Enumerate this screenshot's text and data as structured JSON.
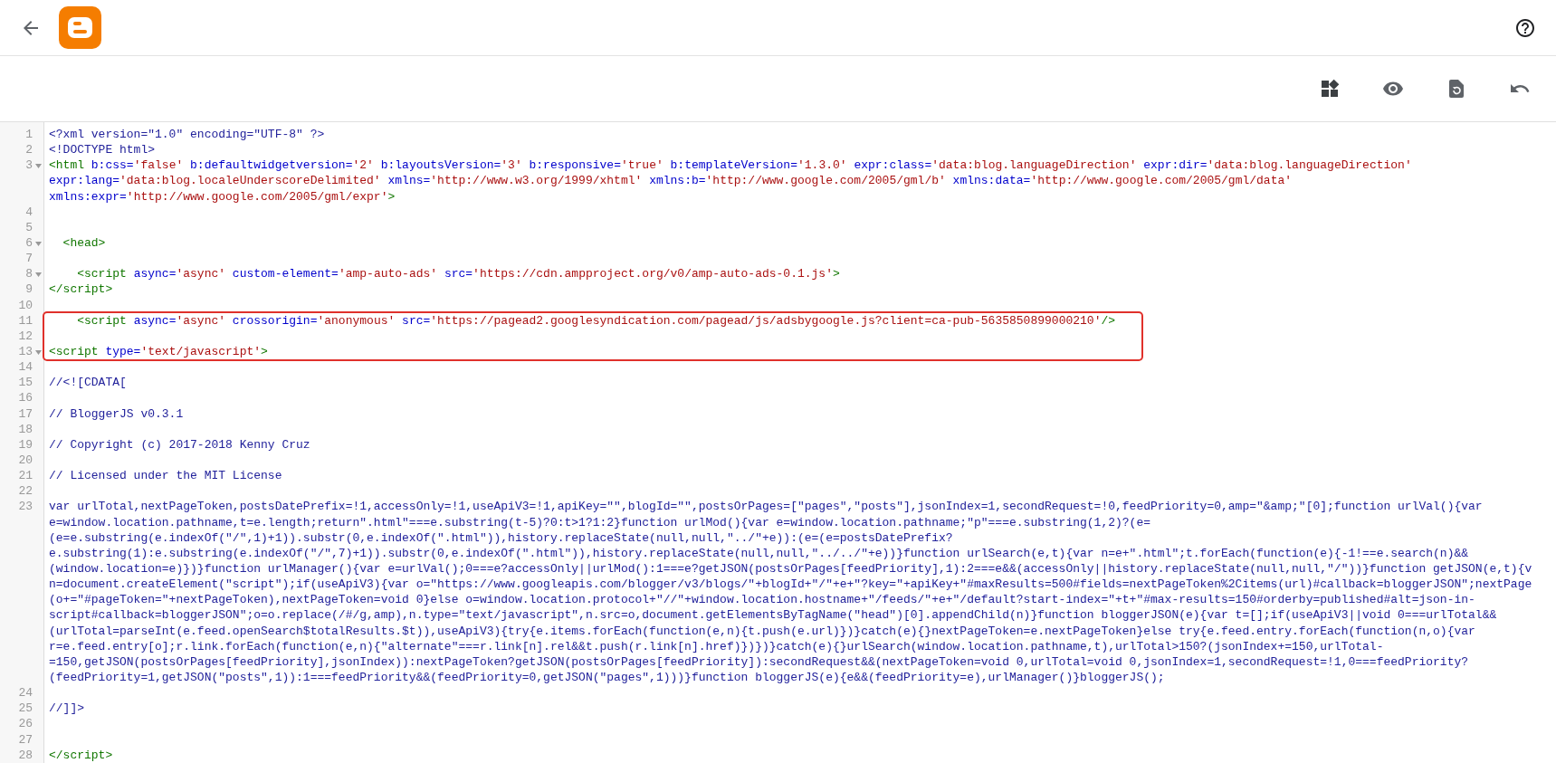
{
  "lines": [
    {
      "number": "1",
      "foldable": false,
      "highlighted": false,
      "rows": [
        {
          "segments": [
            {
              "kind": "plain",
              "text": "<?xml version=\"1.0\" encoding=\"UTF-8\" ?>"
            }
          ]
        }
      ]
    },
    {
      "number": "2",
      "foldable": false,
      "highlighted": false,
      "rows": [
        {
          "segments": [
            {
              "kind": "plain",
              "text": "<!DOCTYPE html>"
            }
          ]
        }
      ]
    },
    {
      "number": "3",
      "foldable": true,
      "highlighted": false,
      "rows": [
        {
          "segments": [
            {
              "kind": "tag",
              "text": "<html"
            },
            {
              "kind": "attr",
              "text": " b:css="
            },
            {
              "kind": "value",
              "text": "'false'"
            },
            {
              "kind": "attr",
              "text": " b:defaultwidgetversion="
            },
            {
              "kind": "value",
              "text": "'2'"
            },
            {
              "kind": "attr",
              "text": " b:layoutsVersion="
            },
            {
              "kind": "value",
              "text": "'3'"
            },
            {
              "kind": "attr",
              "text": " b:responsive="
            },
            {
              "kind": "value",
              "text": "'true'"
            },
            {
              "kind": "attr",
              "text": " b:templateVersion="
            },
            {
              "kind": "value",
              "text": "'1.3.0'"
            },
            {
              "kind": "attr",
              "text": " expr:class="
            },
            {
              "kind": "value",
              "text": "'data:blog.languageDirection'"
            },
            {
              "kind": "attr",
              "text": " expr:dir="
            },
            {
              "kind": "value",
              "text": "'data:blog.languageDirection'"
            }
          ]
        },
        {
          "segments": [
            {
              "kind": "attr",
              "text": "expr:lang="
            },
            {
              "kind": "value",
              "text": "'data:blog.localeUnderscoreDelimited'"
            },
            {
              "kind": "attr",
              "text": " xmlns="
            },
            {
              "kind": "value",
              "text": "'http://www.w3.org/1999/xhtml'"
            },
            {
              "kind": "attr",
              "text": " xmlns:b="
            },
            {
              "kind": "value",
              "text": "'http://www.google.com/2005/gml/b'"
            },
            {
              "kind": "attr",
              "text": " xmlns:data="
            },
            {
              "kind": "value",
              "text": "'http://www.google.com/2005/gml/data'"
            }
          ]
        },
        {
          "segments": [
            {
              "kind": "attr",
              "text": "xmlns:expr="
            },
            {
              "kind": "value",
              "text": "'http://www.google.com/2005/gml/expr'"
            },
            {
              "kind": "tag",
              "text": ">"
            }
          ]
        }
      ]
    },
    {
      "number": "4",
      "foldable": false,
      "highlighted": false
    },
    {
      "number": "5",
      "foldable": false,
      "highlighted": false
    },
    {
      "number": "6",
      "foldable": true,
      "highlighted": false,
      "rows": [
        {
          "segments": [
            {
              "kind": "tag",
              "text": "  <head>"
            }
          ]
        }
      ]
    },
    {
      "number": "7",
      "foldable": false,
      "highlighted": false
    },
    {
      "number": "8",
      "foldable": true,
      "highlighted": false,
      "rows": [
        {
          "segments": [
            {
              "kind": "tag",
              "text": "    <script"
            },
            {
              "kind": "attr",
              "text": " async="
            },
            {
              "kind": "value",
              "text": "'async'"
            },
            {
              "kind": "attr",
              "text": " custom-element="
            },
            {
              "kind": "value",
              "text": "'amp-auto-ads'"
            },
            {
              "kind": "attr",
              "text": " src="
            },
            {
              "kind": "value",
              "text": "'https://cdn.ampproject.org/v0/amp-auto-ads-0.1.js'"
            },
            {
              "kind": "tag",
              "text": ">"
            }
          ]
        }
      ]
    },
    {
      "number": "9",
      "foldable": false,
      "highlighted": false,
      "rows": [
        {
          "segments": [
            {
              "kind": "tag",
              "text": "</script>"
            }
          ]
        }
      ]
    },
    {
      "number": "10",
      "foldable": false,
      "highlighted": false
    },
    {
      "number": "11",
      "foldable": false,
      "highlighted": true,
      "rows": [
        {
          "segments": [
            {
              "kind": "tag",
              "text": "    <script"
            },
            {
              "kind": "attr",
              "text": " async="
            },
            {
              "kind": "value",
              "text": "'async'"
            },
            {
              "kind": "attr",
              "text": " crossorigin="
            },
            {
              "kind": "value",
              "text": "'anonymous'"
            },
            {
              "kind": "attr",
              "text": " src="
            },
            {
              "kind": "value",
              "text": "'https://pagead2.googlesyndication.com/pagead/js/adsbygoogle.js?client=ca-pub-5635850899000210'"
            },
            {
              "kind": "tag",
              "text": "/>"
            }
          ]
        }
      ]
    },
    {
      "number": "12",
      "foldable": false,
      "highlighted": true
    },
    {
      "number": "13",
      "foldable": true,
      "highlighted": true,
      "rows": [
        {
          "segments": [
            {
              "kind": "tag",
              "text": "<script"
            },
            {
              "kind": "attr",
              "text": " type="
            },
            {
              "kind": "value",
              "text": "'text/javascript'"
            },
            {
              "kind": "tag",
              "text": ">"
            }
          ]
        }
      ]
    },
    {
      "number": "14",
      "foldable": false,
      "highlighted": false
    },
    {
      "number": "15",
      "foldable": false,
      "highlighted": false,
      "rows": [
        {
          "segments": [
            {
              "kind": "plain",
              "text": "//<![CDATA["
            }
          ]
        }
      ]
    },
    {
      "number": "16",
      "foldable": false,
      "highlighted": false
    },
    {
      "number": "17",
      "foldable": false,
      "highlighted": false,
      "rows": [
        {
          "segments": [
            {
              "kind": "plain",
              "text": "// BloggerJS v0.3.1"
            }
          ]
        }
      ]
    },
    {
      "number": "18",
      "foldable": false,
      "highlighted": false
    },
    {
      "number": "19",
      "foldable": false,
      "highlighted": false,
      "rows": [
        {
          "segments": [
            {
              "kind": "plain",
              "text": "// Copyright (c) 2017-2018 Kenny Cruz"
            }
          ]
        }
      ]
    },
    {
      "number": "20",
      "foldable": false,
      "highlighted": false
    },
    {
      "number": "21",
      "foldable": false,
      "highlighted": false,
      "rows": [
        {
          "segments": [
            {
              "kind": "plain",
              "text": "// Licensed under the MIT License"
            }
          ]
        }
      ]
    },
    {
      "number": "22",
      "foldable": false,
      "highlighted": false
    },
    {
      "number": "23",
      "foldable": false,
      "highlighted": false,
      "rows": [
        {
          "segments": [
            {
              "kind": "plain",
              "text": "var urlTotal,nextPageToken,postsDatePrefix=!1,accessOnly=!1,useApiV3=!1,apiKey=\"\",blogId=\"\",postsOrPages=[\"pages\",\"posts\"],jsonIndex=1,secondRequest=!0,feedPriority=0,amp=\"&amp;\"[0];function urlVal(){var"
            }
          ]
        },
        {
          "segments": [
            {
              "kind": "plain",
              "text": "e=window.location.pathname,t=e.length;return\".html\"===e.substring(t-5)?0:t>1?1:2}function urlMod(){var e=window.location.pathname;\"p\"===e.substring(1,2)?(e="
            }
          ]
        },
        {
          "segments": [
            {
              "kind": "plain",
              "text": "(e=e.substring(e.indexOf(\"/\",1)+1)).substr(0,e.indexOf(\".html\")),history.replaceState(null,null,\"../\"+e)):(e=(e=postsDatePrefix?"
            }
          ]
        },
        {
          "segments": [
            {
              "kind": "plain",
              "text": "e.substring(1):e.substring(e.indexOf(\"/\",7)+1)).substr(0,e.indexOf(\".html\")),history.replaceState(null,null,\"../../\"+e))}function urlSearch(e,t){var n=e+\".html\";t.forEach(function(e){-1!==e.search(n)&&"
            }
          ]
        },
        {
          "segments": [
            {
              "kind": "plain",
              "text": "(window.location=e)})}function urlManager(){var e=urlVal();0===e?accessOnly||urlMod():1===e?getJSON(postsOrPages[feedPriority],1):2===e&&(accessOnly||history.replaceState(null,null,\"/\"))}function getJSON(e,t){v"
            }
          ]
        },
        {
          "segments": [
            {
              "kind": "plain",
              "text": "n=document.createElement(\"script\");if(useApiV3){var o=\"https://www.googleapis.com/blogger/v3/blogs/\"+blogId+\"/\"+e+\"?key=\"+apiKey+\"#maxResults=500#fields=nextPageToken%2Citems(url)#callback=bloggerJSON\";nextPage"
            }
          ]
        },
        {
          "segments": [
            {
              "kind": "plain",
              "text": "(o+=\"#pageToken=\"+nextPageToken),nextPageToken=void 0}else o=window.location.protocol+\"//\"+window.location.hostname+\"/feeds/\"+e+\"/default?start-index=\"+t+\"#max-results=150#orderby=published#alt=json-in-"
            }
          ]
        },
        {
          "segments": [
            {
              "kind": "plain",
              "text": "script#callback=bloggerJSON\";o=o.replace(/#/g,amp),n.type=\"text/javascript\",n.src=o,document.getElementsByTagName(\"head\")[0].appendChild(n)}function bloggerJSON(e){var t=[];if(useApiV3||void 0===urlTotal&&"
            }
          ]
        },
        {
          "segments": [
            {
              "kind": "plain",
              "text": "(urlTotal=parseInt(e.feed.openSearch$totalResults.$t)),useApiV3){try{e.items.forEach(function(e,n){t.push(e.url)})}catch(e){}nextPageToken=e.nextPageToken}else try{e.feed.entry.forEach(function(n,o){var"
            }
          ]
        },
        {
          "segments": [
            {
              "kind": "plain",
              "text": "r=e.feed.entry[o];r.link.forEach(function(e,n){\"alternate\"===r.link[n].rel&&t.push(r.link[n].href)})})}catch(e){}urlSearch(window.location.pathname,t),urlTotal>150?(jsonIndex+=150,urlTotal-"
            }
          ]
        },
        {
          "segments": [
            {
              "kind": "plain",
              "text": "=150,getJSON(postsOrPages[feedPriority],jsonIndex)):nextPageToken?getJSON(postsOrPages[feedPriority]):secondRequest&&(nextPageToken=void 0,urlTotal=void 0,jsonIndex=1,secondRequest=!1,0===feedPriority?"
            }
          ]
        },
        {
          "segments": [
            {
              "kind": "plain",
              "text": "(feedPriority=1,getJSON(\"posts\",1)):1===feedPriority&&(feedPriority=0,getJSON(\"pages\",1)))}function bloggerJS(e){e&&(feedPriority=e),urlManager()}bloggerJS();"
            }
          ]
        }
      ]
    },
    {
      "number": "24",
      "foldable": false,
      "highlighted": false
    },
    {
      "number": "25",
      "foldable": false,
      "highlighted": false,
      "rows": [
        {
          "segments": [
            {
              "kind": "plain",
              "text": "//]]>"
            }
          ]
        }
      ]
    },
    {
      "number": "26",
      "foldable": false,
      "highlighted": false
    },
    {
      "number": "27",
      "foldable": false,
      "highlighted": false
    },
    {
      "number": "28",
      "foldable": false,
      "highlighted": false,
      "rows": [
        {
          "segments": [
            {
              "kind": "tag",
              "text": "</script>"
            }
          ]
        }
      ]
    }
  ]
}
